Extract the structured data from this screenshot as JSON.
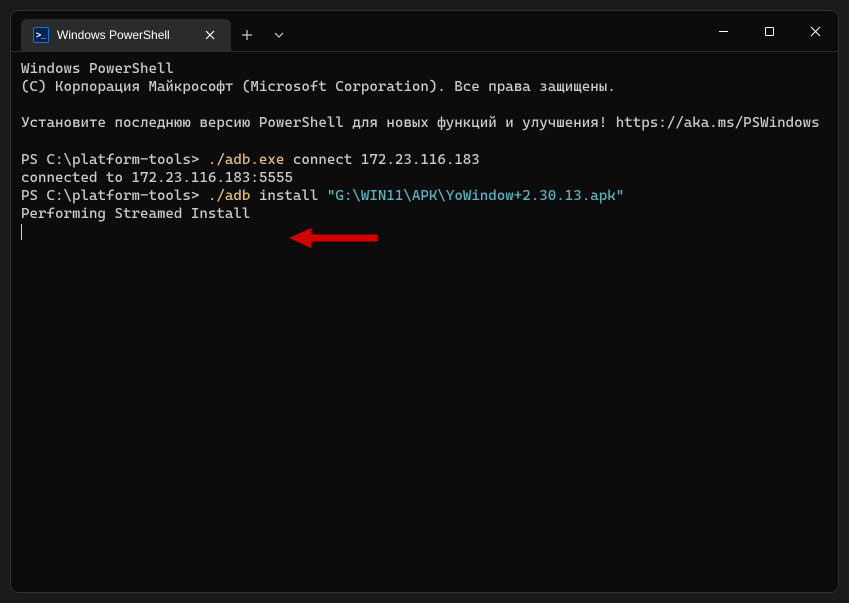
{
  "tab": {
    "title": "Windows PowerShell",
    "icon_text": ">_"
  },
  "terminal": {
    "line1": "Windows PowerShell",
    "line2": "(C) Корпорация Майкрософт (Microsoft Corporation). Все права защищены.",
    "line3": "Установите последнюю версию PowerShell для новых функций и улучшения! https://aka.ms/PSWindows",
    "prompt1": "PS C:\\platform-tools> ",
    "cmd1_exec": "./adb.exe",
    "cmd1_args": " connect 172.23.116.183",
    "line_connected": "connected to 172.23.116.183:5555",
    "prompt2": "PS C:\\platform-tools> ",
    "cmd2_exec": "./adb",
    "cmd2_args": " install ",
    "cmd2_path": "\"G:\\WIN11\\APK\\YoWindow+2.30.13.apk\"",
    "line_perform": "Performing Streamed Install"
  }
}
